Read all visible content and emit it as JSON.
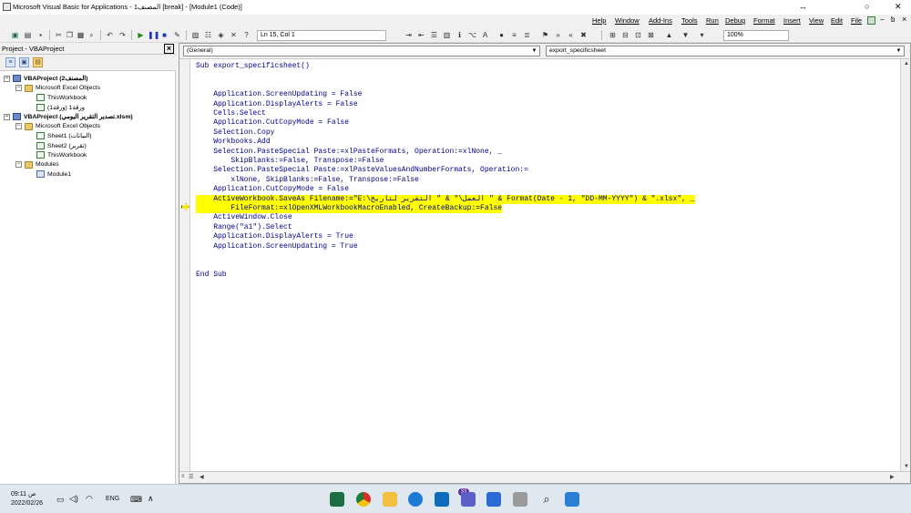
{
  "window": {
    "title": "Microsoft Visual Basic for Applications - المصنف1 [break] - [Module1 (Code)]",
    "controls": [
      "↔",
      "○",
      "✕"
    ]
  },
  "menubar": {
    "items": [
      "Help",
      "Window",
      "Add-Ins",
      "Tools",
      "Run",
      "Debug",
      "Format",
      "Insert",
      "View",
      "Edit",
      "File"
    ],
    "doc_controls": [
      "−",
      "ƅ",
      "×"
    ]
  },
  "toolbar": {
    "cursor_pos": "Ln 15, Col 1",
    "zoom": "100%"
  },
  "project_panel": {
    "title": "Project - VBAProject",
    "tree": [
      {
        "label": "VBAProject (المصنف2)",
        "level": 0,
        "expanded": true,
        "icon": "project-icon",
        "bold": true
      },
      {
        "label": "Microsoft Excel Objects",
        "level": 1,
        "expanded": true,
        "icon": "folder-icon"
      },
      {
        "label": "ThisWorkbook",
        "level": 2,
        "icon": "workbook-icon"
      },
      {
        "label": "ورقة1 (ورقة1)",
        "level": 2,
        "icon": "worksheet-icon"
      },
      {
        "label": "VBAProject (تصدير التقرير اليومي.xlsm)",
        "level": 0,
        "expanded": true,
        "icon": "project-icon",
        "bold": true
      },
      {
        "label": "Microsoft Excel Objects",
        "level": 1,
        "expanded": true,
        "icon": "folder-icon"
      },
      {
        "label": "Sheet1 (البيانات)",
        "level": 2,
        "icon": "worksheet-icon"
      },
      {
        "label": "Sheet2 (تقرير)",
        "level": 2,
        "icon": "worksheet-icon"
      },
      {
        "label": "ThisWorkbook",
        "level": 2,
        "icon": "workbook-icon"
      },
      {
        "label": "Modules",
        "level": 1,
        "expanded": true,
        "icon": "folder-icon"
      },
      {
        "label": "Module1",
        "level": 2,
        "icon": "module-icon"
      }
    ]
  },
  "code_window": {
    "object_combo": "(General)",
    "proc_combo": "export_specificsheet",
    "lines": [
      {
        "text": "Sub export_specificsheet()"
      },
      {
        "text": ""
      },
      {
        "text": ""
      },
      {
        "text": "    Application.ScreenUpdating = False"
      },
      {
        "text": "    Application.DisplayAlerts = False"
      },
      {
        "text": "    Cells.Select"
      },
      {
        "text": "    Application.CutCopyMode = False"
      },
      {
        "text": "    Selection.Copy"
      },
      {
        "text": "    Workbooks.Add"
      },
      {
        "text": "    Selection.PasteSpecial Paste:=xlPasteFormats, Operation:=xlNone, _"
      },
      {
        "text": "        SkipBlanks:=False, Transpose:=False"
      },
      {
        "text": "    Selection.PasteSpecial Paste:=xlPasteValuesAndNumberFormats, Operation:="
      },
      {
        "text": "        xlNone, SkipBlanks:=False, Transpose:=False"
      },
      {
        "text": "    Application.CutCopyMode = False"
      },
      {
        "text": "    ActiveWorkbook.SaveAs Filename:=\"E:\\العمل\\\" & \" التقرير لتاريخ \" & Format(Date - 1, \"DD-MM-YYYY\") & \".xlsx\", _",
        "highlight": true
      },
      {
        "text": "        FileFormat:=xlOpenXMLWorkbookMacroEnabled, CreateBackup:=False",
        "highlight": true
      },
      {
        "text": "    ActiveWindow.Close"
      },
      {
        "text": "    Range(\"a1\").Select"
      },
      {
        "text": "    Application.DisplayAlerts = True"
      },
      {
        "text": "    Application.ScreenUpdating = True"
      },
      {
        "text": ""
      },
      {
        "text": ""
      },
      {
        "text": "End Sub"
      }
    ]
  },
  "taskbar": {
    "time": "09:11 ص",
    "date": "2022/02/26",
    "lang": "ENG",
    "notification_badge": "33",
    "colors": {
      "excel": "#1d6f42",
      "chrome": "#e8a33a",
      "explorer": "#f0c040",
      "edge": "#1a7ad4",
      "outlook": "#0f6cbd",
      "teams": "#5b5fc7",
      "windows": "#2a7fd4"
    }
  }
}
